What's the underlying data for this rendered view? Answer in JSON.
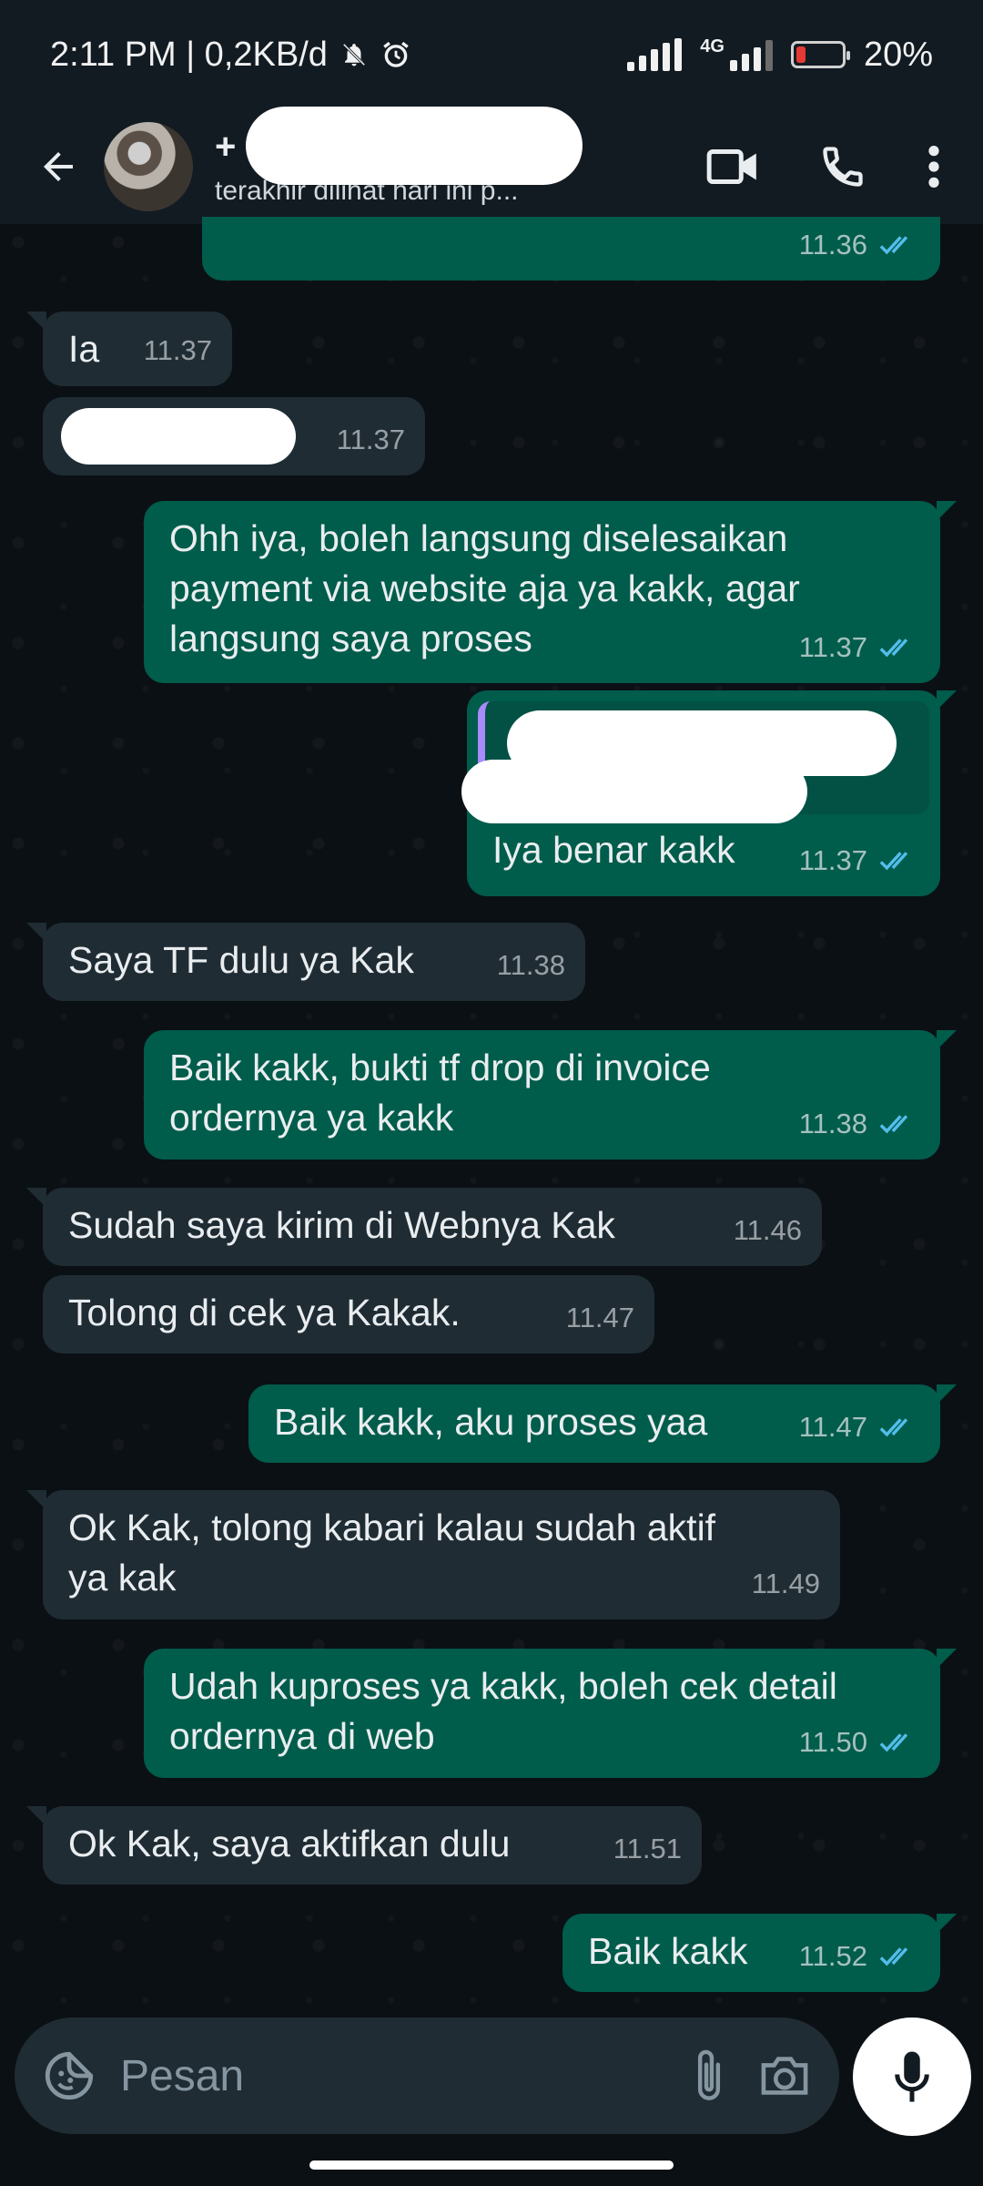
{
  "status_bar": {
    "time_info": "2:11 PM | 0,2KB/d",
    "net_tag": "4G",
    "battery": "20%",
    "battery_level": 0.2
  },
  "header": {
    "contact_prefix": "+",
    "last_seen": "terakhir dilihat hari ini p..."
  },
  "messages": [
    {
      "dir": "out",
      "text": "",
      "time": "11.36",
      "read": true
    },
    {
      "dir": "in",
      "text": "Ia",
      "time": "11.37"
    },
    {
      "dir": "in",
      "text": "",
      "time": "11.37",
      "redacted": true
    },
    {
      "dir": "out",
      "text": "Ohh iya, boleh langsung diselesaikan payment via website aja ya kakk, agar langsung saya proses",
      "time": "11.37",
      "read": true
    },
    {
      "dir": "out",
      "text": "Iya benar kakk",
      "time": "11.37",
      "read": true,
      "quoted": true
    },
    {
      "dir": "in",
      "text": "Saya TF dulu ya Kak",
      "time": "11.38"
    },
    {
      "dir": "out",
      "text": "Baik kakk, bukti tf drop di invoice ordernya ya kakk",
      "time": "11.38",
      "read": true
    },
    {
      "dir": "in",
      "text": "Sudah saya kirim di Webnya Kak",
      "time": "11.46"
    },
    {
      "dir": "in",
      "text": "Tolong di cek ya Kakak.",
      "time": "11.47"
    },
    {
      "dir": "out",
      "text": "Baik kakk, aku proses yaa",
      "time": "11.47",
      "read": true
    },
    {
      "dir": "in",
      "text": "Ok Kak, tolong kabari kalau sudah aktif ya kak",
      "time": "11.49"
    },
    {
      "dir": "out",
      "text": "Udah kuproses ya kakk, boleh cek detail ordernya di web",
      "time": "11.50",
      "read": true
    },
    {
      "dir": "in",
      "text": "Ok Kak, saya aktifkan dulu",
      "time": "11.51"
    },
    {
      "dir": "out",
      "text": "Baik kakk",
      "time": "11.52",
      "read": true
    }
  ],
  "composer": {
    "placeholder": "Pesan"
  },
  "icons": [
    "back-arrow-icon",
    "video-call-icon",
    "phone-icon",
    "more-vert-icon",
    "sticker-icon",
    "attach-icon",
    "camera-icon",
    "mic-icon"
  ],
  "colors": {
    "incoming_bubble": "#1f2c34",
    "outgoing_bubble": "#005c4b",
    "read_tick": "#53bdeb",
    "background": "#0b1014"
  }
}
